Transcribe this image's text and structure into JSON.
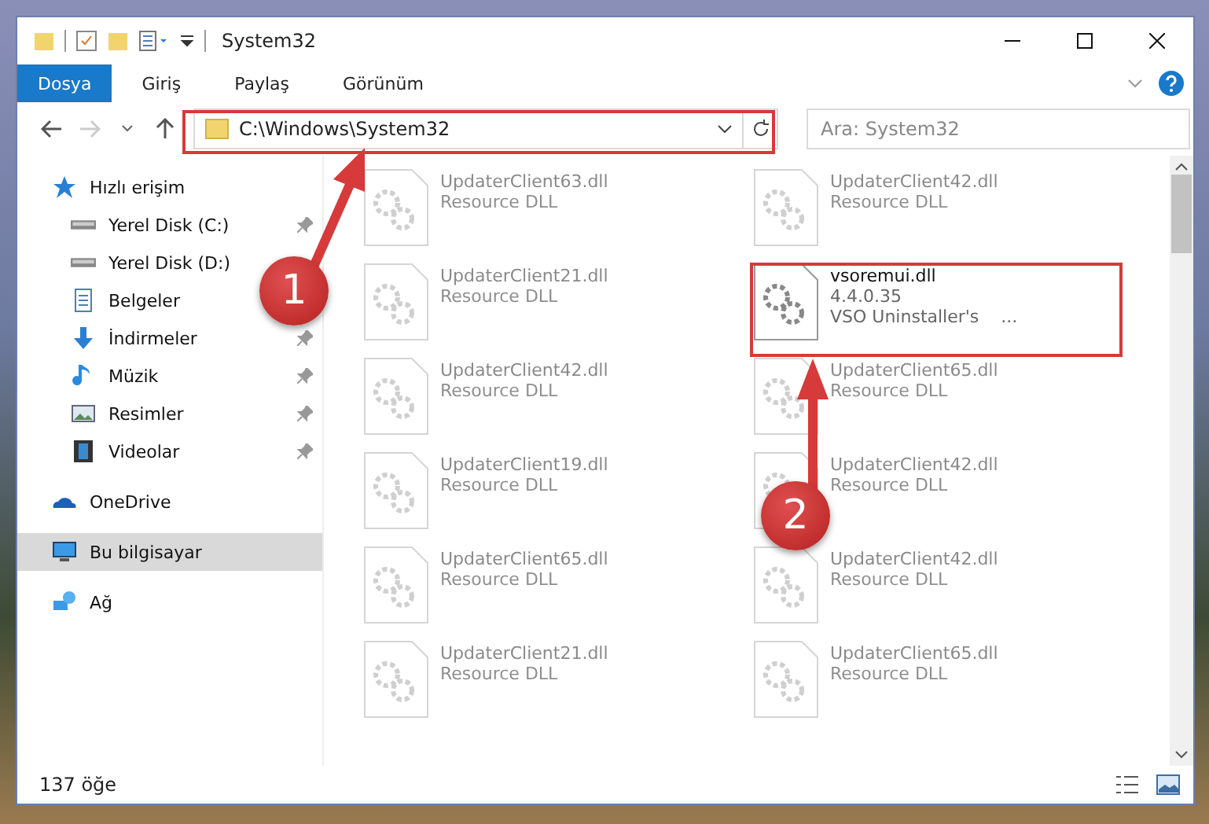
{
  "window": {
    "title": "System32"
  },
  "ribbon_tabs": [
    {
      "label": "Dosya",
      "selected": true
    },
    {
      "label": "Giriş",
      "selected": false
    },
    {
      "label": "Paylaş",
      "selected": false
    },
    {
      "label": "Görünüm",
      "selected": false
    }
  ],
  "address": {
    "path": "C:\\Windows\\System32"
  },
  "search": {
    "placeholder": "Ara: System32"
  },
  "sidebar": {
    "items": [
      {
        "label": "Hızlı erişim",
        "kind": "star",
        "selected": false,
        "children": [
          {
            "label": "Yerel Disk (C:)",
            "kind": "drive",
            "pinned": true,
            "selected": false
          },
          {
            "label": "Yerel Disk (D:)",
            "kind": "drive",
            "pinned": false,
            "selected": false
          },
          {
            "label": "Belgeler",
            "kind": "docs",
            "pinned": false,
            "selected": false
          },
          {
            "label": "İndirmeler",
            "kind": "download",
            "pinned": true,
            "selected": false
          },
          {
            "label": "Müzik",
            "kind": "music",
            "pinned": true,
            "selected": false
          },
          {
            "label": "Resimler",
            "kind": "pictures",
            "pinned": true,
            "selected": false
          },
          {
            "label": "Videolar",
            "kind": "video",
            "pinned": true,
            "selected": false
          }
        ]
      },
      {
        "label": "OneDrive",
        "kind": "cloud",
        "selected": false
      },
      {
        "label": "Bu bilgisayar",
        "kind": "computer",
        "selected": true
      },
      {
        "label": "Ağ",
        "kind": "network",
        "selected": false
      }
    ]
  },
  "files": [
    {
      "name": "UpdaterClient63.dll",
      "lines": [
        "Resource DLL"
      ],
      "highlighted": false
    },
    {
      "name": "UpdaterClient42.dll",
      "lines": [
        "Resource DLL"
      ],
      "highlighted": false
    },
    {
      "name": "UpdaterClient21.dll",
      "lines": [
        "Resource DLL"
      ],
      "highlighted": false
    },
    {
      "name": "vsoremui.dll",
      "lines": [
        "4.4.0.35",
        "VSO Uninstaller's    ..."
      ],
      "highlighted": true
    },
    {
      "name": "UpdaterClient42.dll",
      "lines": [
        "Resource DLL"
      ],
      "highlighted": false
    },
    {
      "name": "UpdaterClient65.dll",
      "lines": [
        "Resource DLL"
      ],
      "highlighted": false
    },
    {
      "name": "UpdaterClient19.dll",
      "lines": [
        "Resource DLL"
      ],
      "highlighted": false
    },
    {
      "name": "UpdaterClient42.dll",
      "lines": [
        "Resource DLL"
      ],
      "highlighted": false
    },
    {
      "name": "UpdaterClient65.dll",
      "lines": [
        "Resource DLL"
      ],
      "highlighted": false
    },
    {
      "name": "UpdaterClient42.dll",
      "lines": [
        "Resource DLL"
      ],
      "highlighted": false
    },
    {
      "name": "UpdaterClient21.dll",
      "lines": [
        "Resource DLL"
      ],
      "highlighted": false
    },
    {
      "name": "UpdaterClient65.dll",
      "lines": [
        "Resource DLL"
      ],
      "highlighted": false
    }
  ],
  "callouts": [
    {
      "number": "1"
    },
    {
      "number": "2"
    }
  ],
  "status_bar": {
    "count": "137 öğe"
  }
}
